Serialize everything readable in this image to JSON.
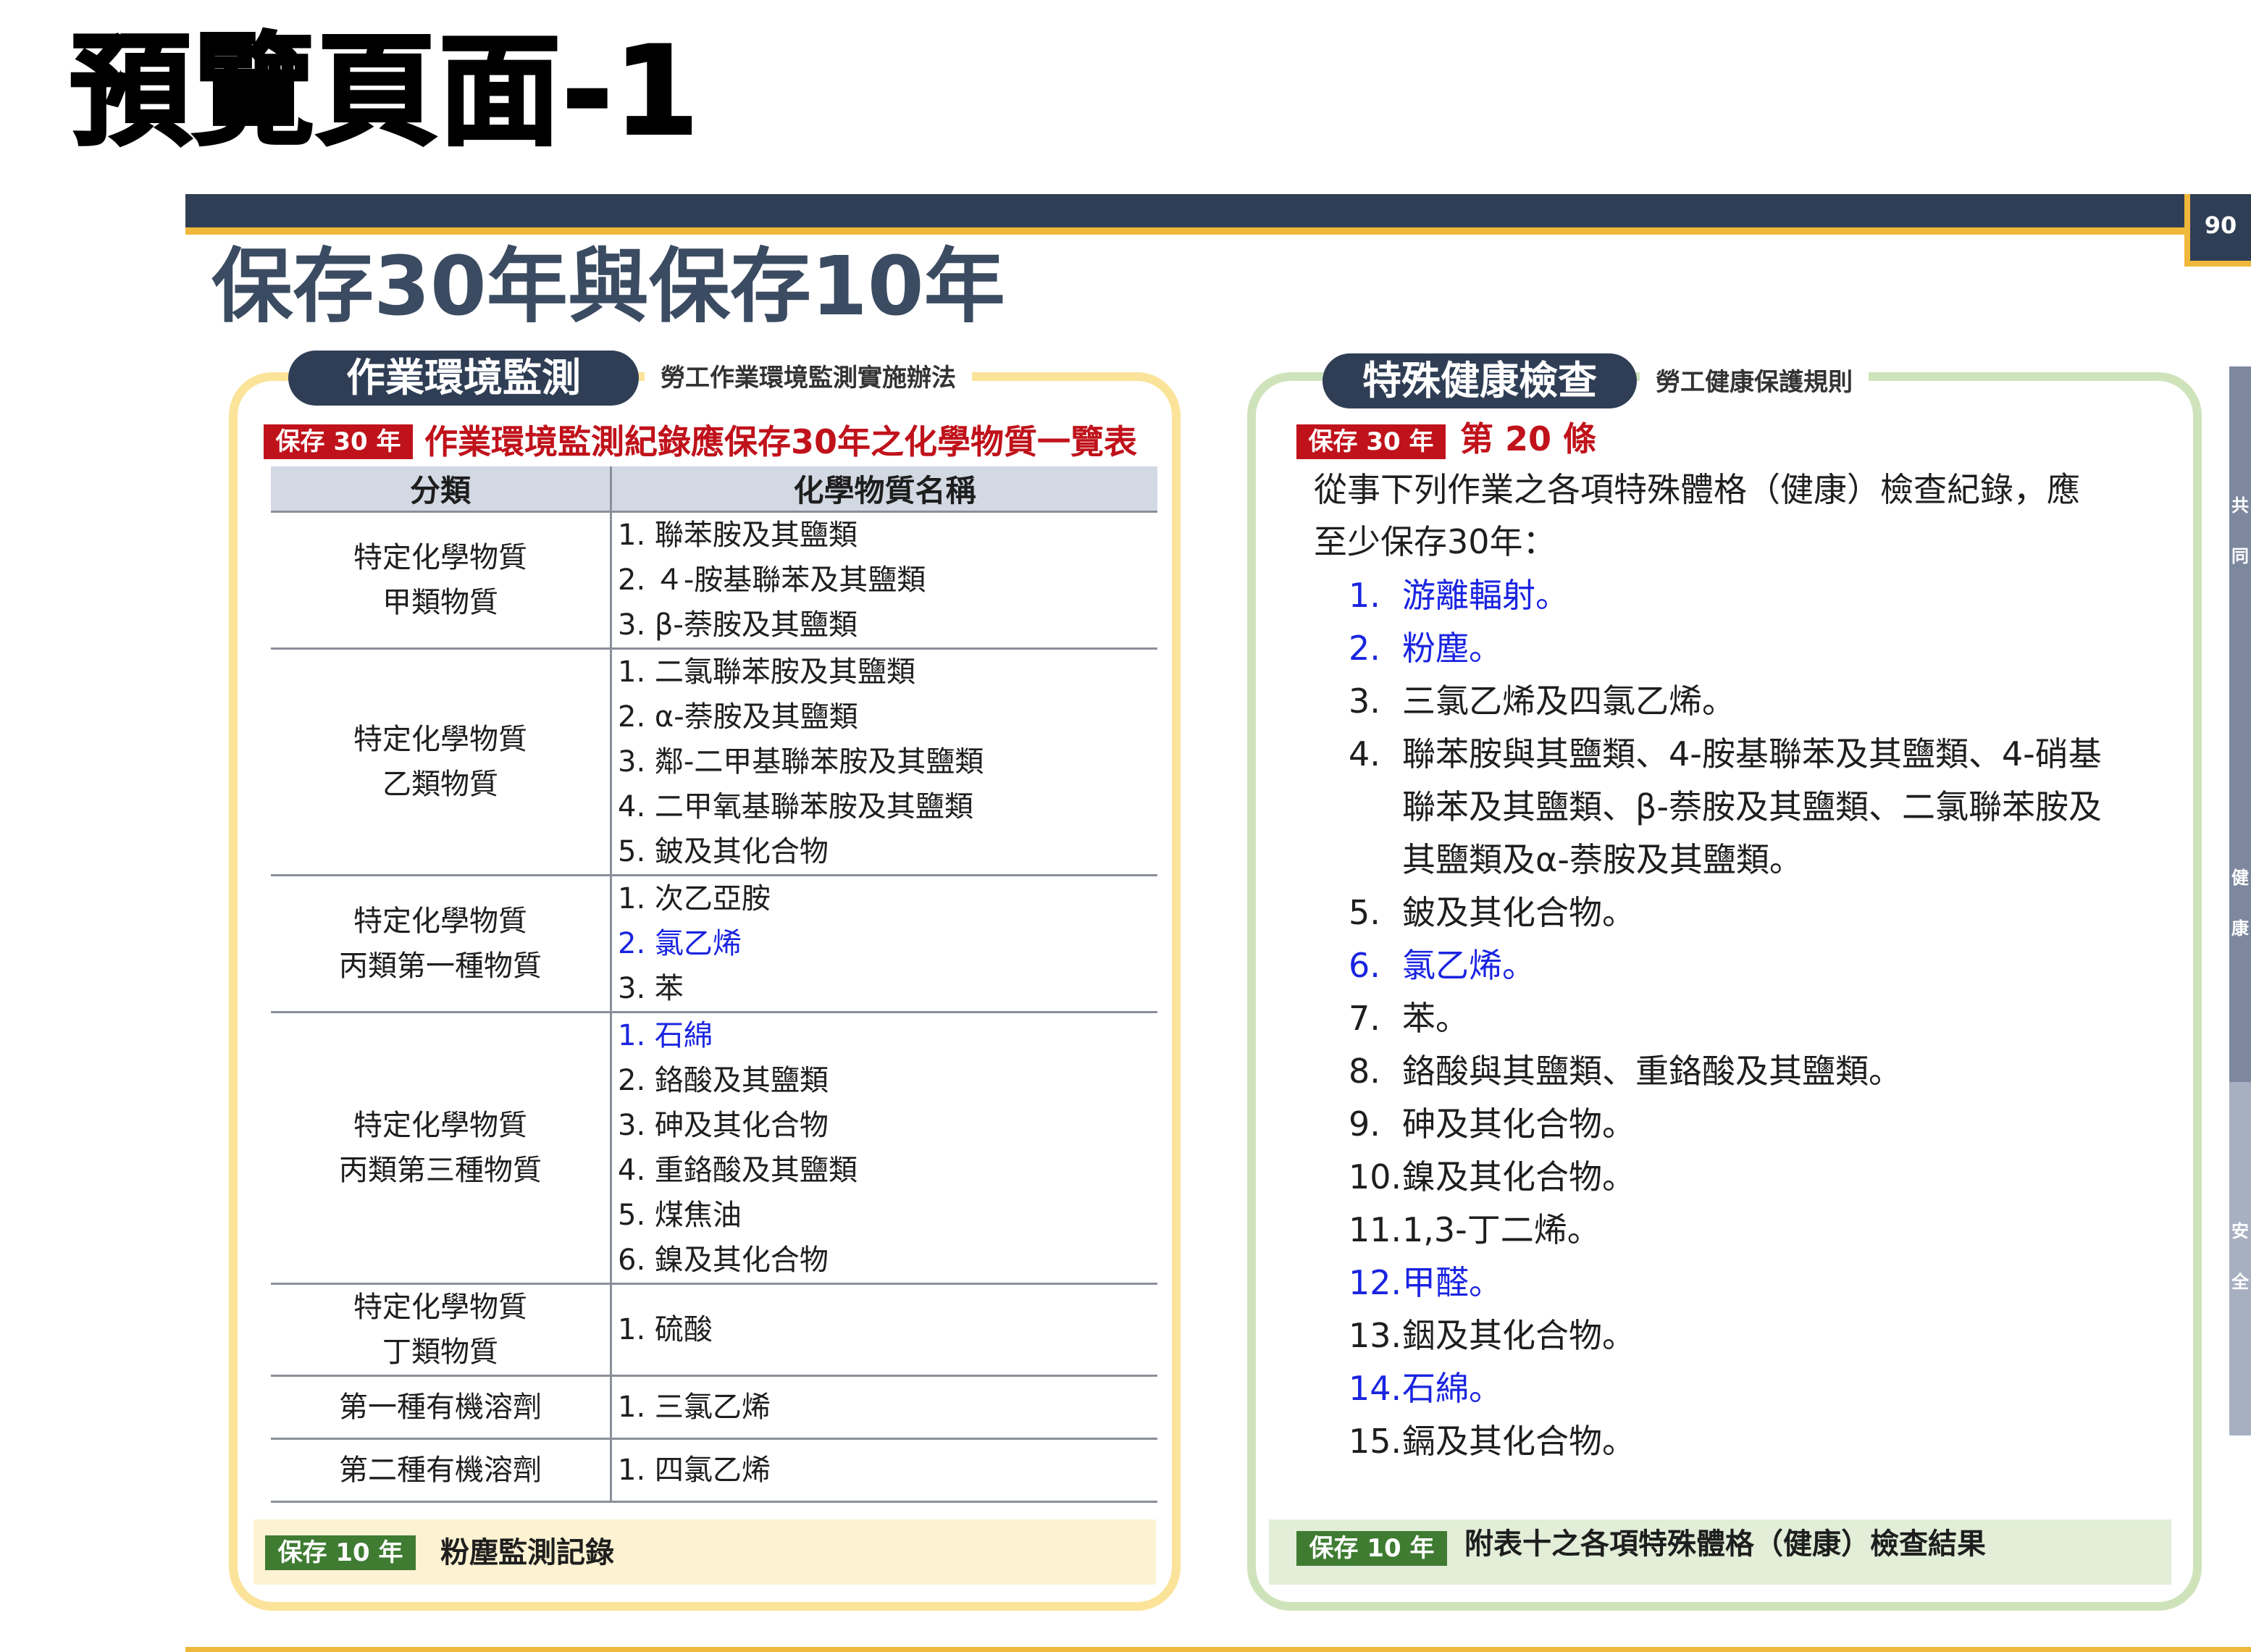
{
  "preview_heading": "預覽頁面-1",
  "page_number": "90",
  "slide_title": "保存30年與保存10年",
  "left": {
    "pill": "作業環境監測",
    "pill_sub": "勞工作業環境監測實施辦法",
    "tag_30": "保存 30 年",
    "red_title": "作業環境監測紀錄應保存30年之化學物質一覽表",
    "table": {
      "headers": [
        "分類",
        "化學物質名稱"
      ],
      "groups": [
        {
          "category": [
            "特定化學物質",
            "甲類物質"
          ],
          "items": [
            {
              "text": "1. 聯苯胺及其鹽類",
              "hl": false
            },
            {
              "text": "2. ４-胺基聯苯及其鹽類",
              "hl": false
            },
            {
              "text": "3. β-萘胺及其鹽類",
              "hl": false
            }
          ]
        },
        {
          "category": [
            "特定化學物質",
            "乙類物質"
          ],
          "items": [
            {
              "text": "1. 二氯聯苯胺及其鹽類",
              "hl": false
            },
            {
              "text": "2. α-萘胺及其鹽類",
              "hl": false
            },
            {
              "text": "3. 鄰-二甲基聯苯胺及其鹽類",
              "hl": false
            },
            {
              "text": "4. 二甲氧基聯苯胺及其鹽類",
              "hl": false
            },
            {
              "text": "5. 鈹及其化合物",
              "hl": false
            }
          ]
        },
        {
          "category": [
            "特定化學物質",
            "丙類第一種物質"
          ],
          "items": [
            {
              "text": "1. 次乙亞胺",
              "hl": false
            },
            {
              "text": "2. 氯乙烯",
              "hl": true
            },
            {
              "text": "3. 苯",
              "hl": false
            }
          ]
        },
        {
          "category": [
            "特定化學物質",
            "丙類第三種物質"
          ],
          "items": [
            {
              "text": "1. 石綿",
              "hl": true
            },
            {
              "text": "2. 鉻酸及其鹽類",
              "hl": false
            },
            {
              "text": "3. 砷及其化合物",
              "hl": false
            },
            {
              "text": "4. 重鉻酸及其鹽類",
              "hl": false
            },
            {
              "text": "5. 煤焦油",
              "hl": false
            },
            {
              "text": "6. 鎳及其化合物",
              "hl": false
            }
          ]
        },
        {
          "category": [
            "特定化學物質",
            "丁類物質"
          ],
          "items": [
            {
              "text": "1. 硫酸",
              "hl": false
            }
          ]
        },
        {
          "category": [
            "第一種有機溶劑"
          ],
          "items": [
            {
              "text": "1. 三氯乙烯",
              "hl": false
            }
          ]
        },
        {
          "category": [
            "第二種有機溶劑"
          ],
          "items": [
            {
              "text": "1. 四氯乙烯",
              "hl": false
            }
          ]
        }
      ]
    },
    "tag_10": "保存 10 年",
    "bottom_text": "粉塵監測記錄"
  },
  "right": {
    "pill": "特殊健康檢查",
    "pill_sub": "勞工健康保護規則",
    "tag_30": "保存 30 年",
    "red_title": "第 20 條",
    "intro": [
      "從事下列作業之各項特殊體格（健康）檢查紀錄，應",
      "至少保存30年："
    ],
    "list": [
      {
        "num": "1.",
        "lines": [
          "游離輻射。"
        ],
        "hl": true
      },
      {
        "num": "2.",
        "lines": [
          "粉塵。"
        ],
        "hl": true
      },
      {
        "num": "3.",
        "lines": [
          "三氯乙烯及四氯乙烯。"
        ],
        "hl": false
      },
      {
        "num": "4.",
        "lines": [
          "聯苯胺與其鹽類、4-胺基聯苯及其鹽類、4-硝基",
          "聯苯及其鹽類、β-萘胺及其鹽類、二氯聯苯胺及",
          "其鹽類及α-萘胺及其鹽類。"
        ],
        "hl": false
      },
      {
        "num": "5.",
        "lines": [
          "鈹及其化合物。"
        ],
        "hl": false
      },
      {
        "num": "6.",
        "lines": [
          "氯乙烯。"
        ],
        "hl": true
      },
      {
        "num": "7.",
        "lines": [
          "苯。"
        ],
        "hl": false
      },
      {
        "num": "8.",
        "lines": [
          "鉻酸與其鹽類、重鉻酸及其鹽類。"
        ],
        "hl": false
      },
      {
        "num": "9.",
        "lines": [
          "砷及其化合物。"
        ],
        "hl": false
      },
      {
        "num": "10.",
        "lines": [
          "鎳及其化合物。"
        ],
        "hl": false
      },
      {
        "num": "11.",
        "lines": [
          "1,3-丁二烯。"
        ],
        "hl": false
      },
      {
        "num": "12.",
        "lines": [
          "甲醛。"
        ],
        "hl": true
      },
      {
        "num": "13.",
        "lines": [
          "銦及其化合物。"
        ],
        "hl": false
      },
      {
        "num": "14.",
        "lines": [
          "石綿。"
        ],
        "hl": true
      },
      {
        "num": "15.",
        "lines": [
          "鎘及其化合物。"
        ],
        "hl": false
      }
    ],
    "tag_10": "保存 10 年",
    "bottom_text": "附表十之各項特殊體格（健康）檢查結果"
  },
  "side_tab": {
    "top": [
      "共",
      "同",
      "健",
      "康"
    ],
    "bottom": [
      "安",
      "全"
    ]
  },
  "colors": {
    "navy": "#2f3e55",
    "gold": "#f0b83a",
    "red": "#c0121b",
    "green": "#3f7c32",
    "highlight_blue": "#1a24e0"
  }
}
